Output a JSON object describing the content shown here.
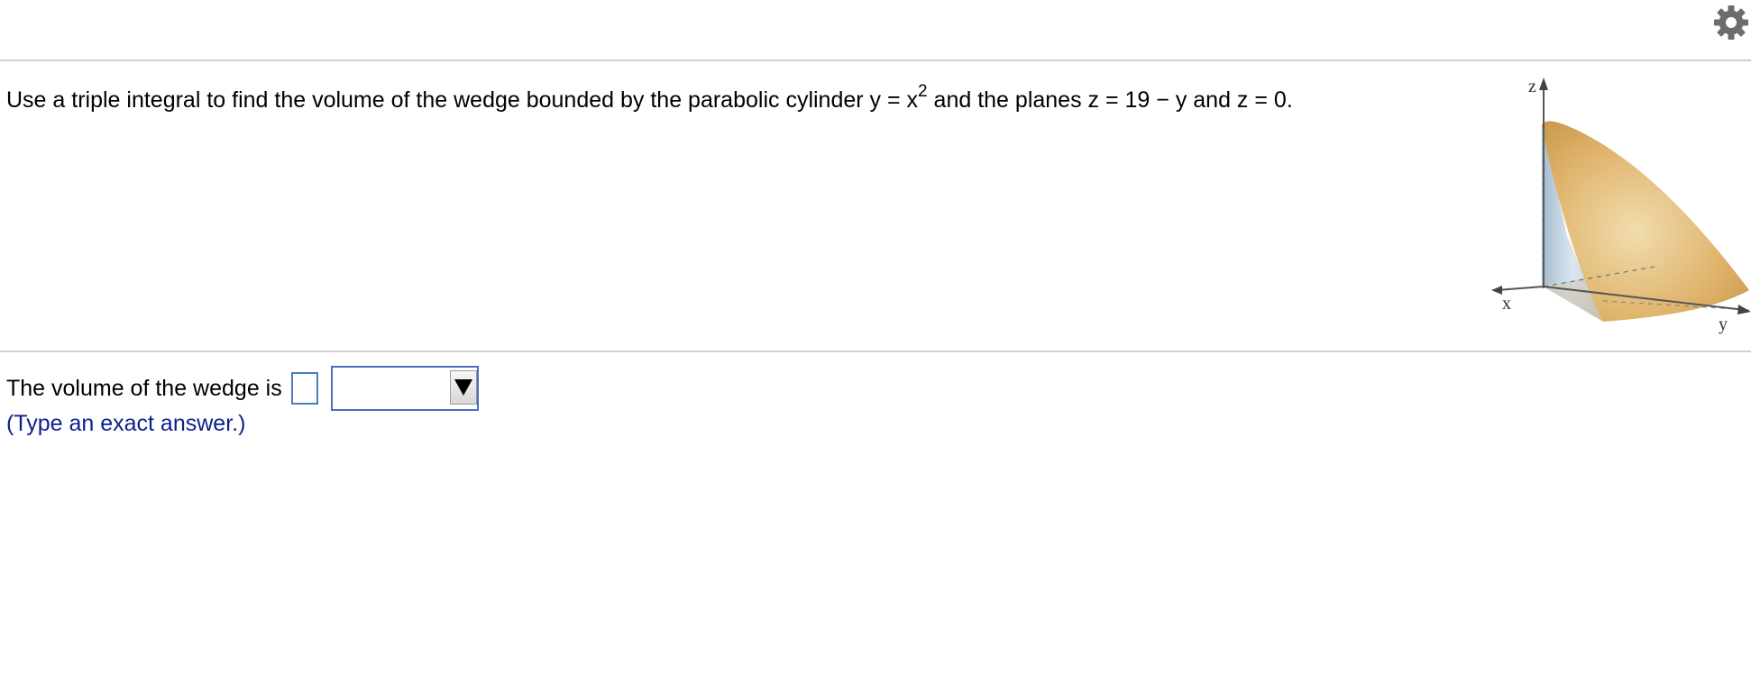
{
  "header": {
    "settings_icon": "gear-icon"
  },
  "question": {
    "part1": "Use a triple integral to find the volume of the wedge bounded by the parabolic cylinder y = x",
    "exponent": "2",
    "part2": " and the planes z = 19 − y and z = 0."
  },
  "figure": {
    "axis_z": "z",
    "axis_x": "x",
    "axis_y": "y",
    "surface_color": "#d9aa5a",
    "side_color": "#b9cbd9"
  },
  "answer": {
    "prefix": "The volume of the wedge is",
    "value": "",
    "unit_value": "",
    "hint": "(Type an exact answer.)"
  },
  "colors": {
    "input_border": "#4a7fb5",
    "hint_text": "#0b1f8c"
  }
}
